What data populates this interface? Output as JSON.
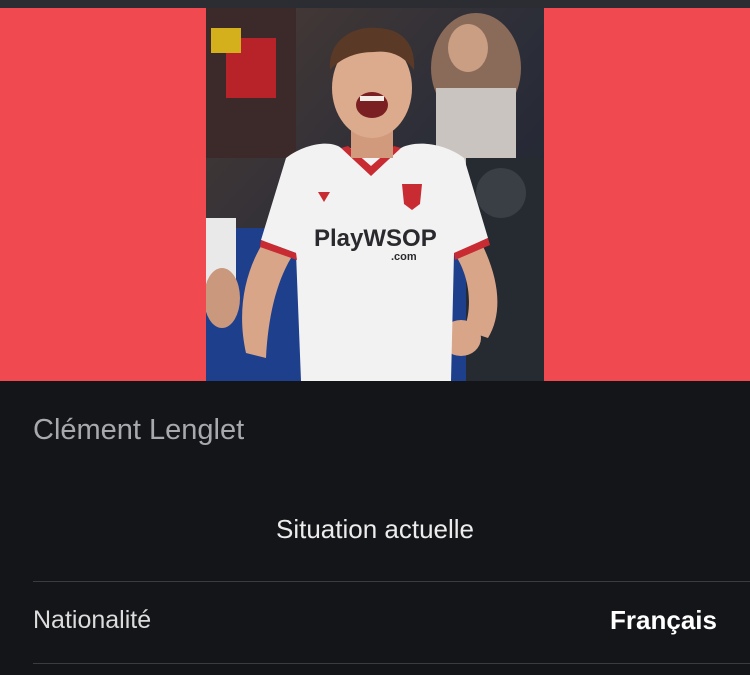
{
  "colors": {
    "hero_background": "#f04a50",
    "page_background": "#141519",
    "divider": "#3a3c42"
  },
  "player": {
    "name": "Clément Lenglet",
    "photo_icon": "player-photo",
    "shirt_sponsor": "PlayWSOP",
    "shirt_sponsor_sub": ".com"
  },
  "section": {
    "title": "Situation actuelle"
  },
  "details": [
    {
      "label": "Nationalité",
      "value": "Français"
    }
  ]
}
